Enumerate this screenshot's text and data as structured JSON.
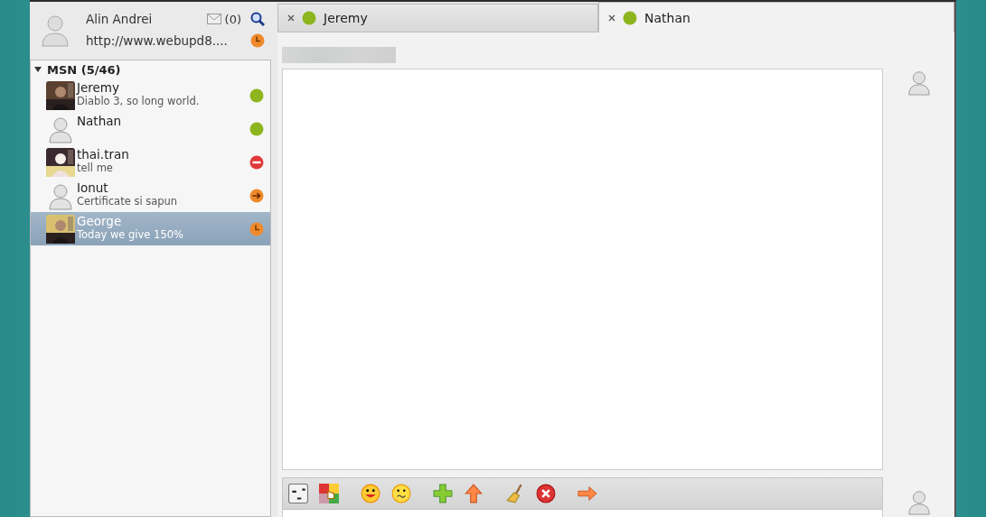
{
  "account": {
    "name": "Alin Andrei",
    "message": "http://www.webupd8....",
    "mail_count": "(0)",
    "status": {
      "kind": "idle",
      "color": "#ee8a2c"
    }
  },
  "group": {
    "label": "MSN (5/46)",
    "expanded": true
  },
  "contacts": [
    {
      "name": "Jeremy",
      "message": "Diablo 3, so long world.",
      "status": {
        "kind": "online",
        "color": "#8db51e"
      },
      "kind": "picture",
      "selected": false
    },
    {
      "name": "Nathan",
      "status": {
        "kind": "online",
        "color": "#8db51e"
      },
      "selected": false
    },
    {
      "name": "thai.tran",
      "message": "tell me",
      "status": {
        "kind": "busy",
        "color": "#e03a3a"
      },
      "kind": "picture",
      "selected": false
    },
    {
      "name": "Ionut",
      "message": "Certificate si sapun",
      "status": {
        "kind": "away",
        "color": "#ee8a2c"
      },
      "selected": false
    },
    {
      "name": "George",
      "message": "Today we give 150%",
      "status": {
        "kind": "idle",
        "color": "#ee8a2c"
      },
      "kind": "picture",
      "selected": true
    }
  ],
  "tabs": [
    {
      "label": "Jeremy",
      "status": {
        "kind": "online",
        "color": "#8db51e"
      },
      "selected": false
    },
    {
      "label": "Nathan",
      "status": {
        "kind": "online",
        "color": "#8db51e"
      },
      "selected": true
    }
  ]
}
